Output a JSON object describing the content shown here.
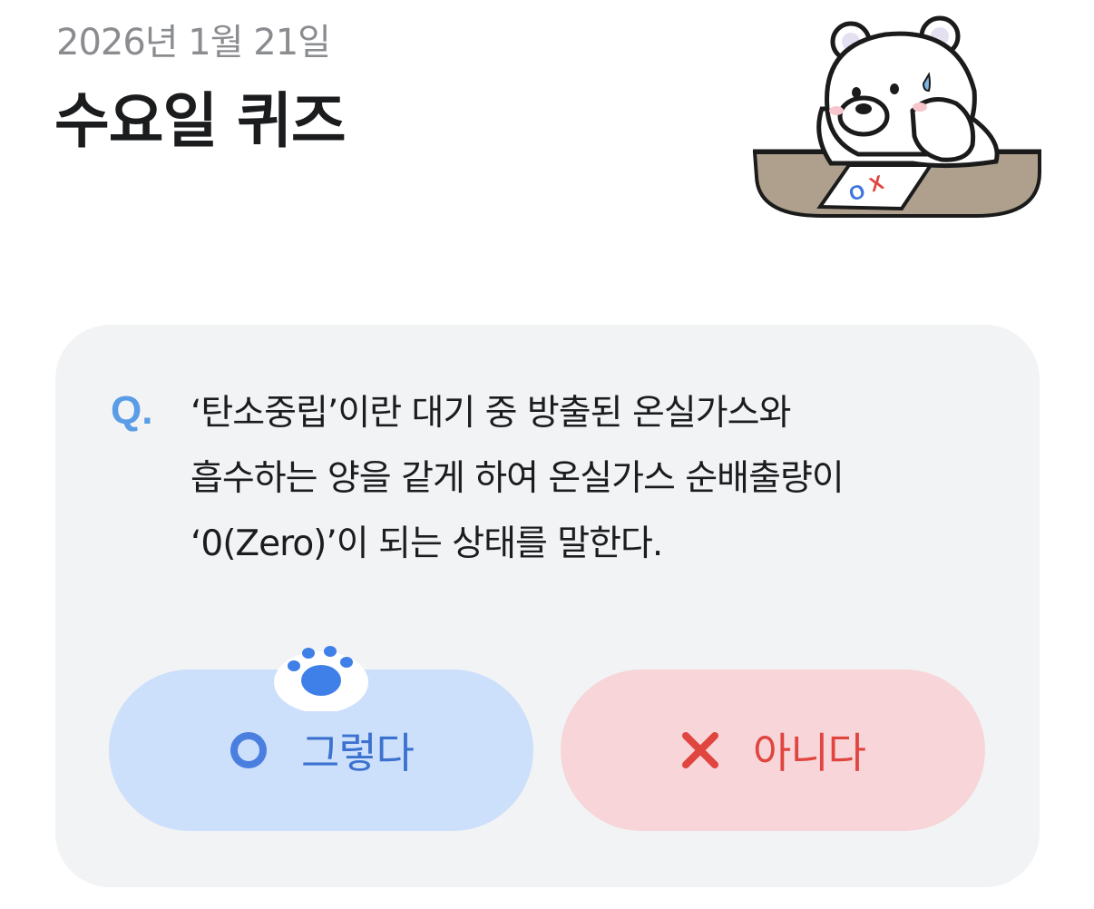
{
  "header": {
    "date": "2026년 1월 21일",
    "title": "수요일 퀴즈"
  },
  "mascot": {
    "icon": "polar-bear-thinking-icon",
    "paper_text": "OX"
  },
  "quiz": {
    "q_label": "Q.",
    "question_lines": [
      "‘탄소중립’이란 대기 중 방출된 온실가스와",
      "흡수하는 양을 같게 하여 온실가스 순배출량이",
      "‘0(Zero)’이 되는 상태를 말한다."
    ]
  },
  "answers": {
    "yes": {
      "label": "그렇다",
      "icon": "circle-o-icon",
      "color": "#3c72cf",
      "background": "#ccdffb"
    },
    "no": {
      "label": "아니다",
      "icon": "x-mark-icon",
      "color": "#e0453f",
      "background": "#f7d5d8"
    },
    "selected_marker_icon": "paw-icon"
  },
  "colors": {
    "q_accent": "#5a9ce6",
    "card_background": "#f2f3f5"
  }
}
